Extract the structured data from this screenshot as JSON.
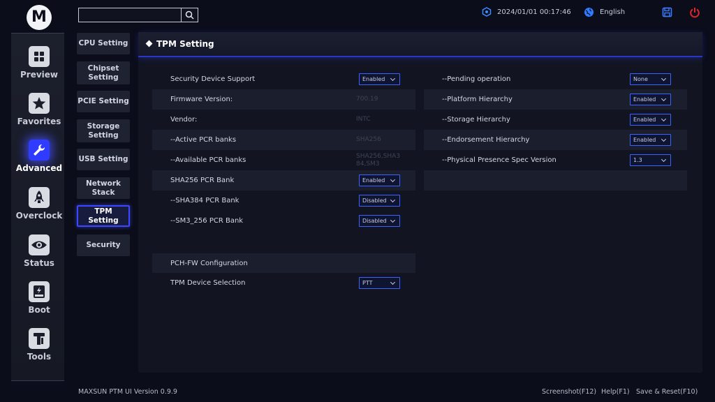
{
  "app": {
    "logo_letter": "M",
    "version": "MAXSUN PTM UI Version 0.9.9"
  },
  "top": {
    "search_placeholder": "",
    "datetime": "2024/01/01 00:17:46",
    "language": "English"
  },
  "colors": {
    "accent": "#2f3cff",
    "dropdown_border": "#3a66ff",
    "power": "#e0262b",
    "save": "#3a7bff"
  },
  "nav": [
    {
      "label": "Preview",
      "icon": "grid-icon",
      "active": false
    },
    {
      "label": "Favorites",
      "icon": "star-icon",
      "active": false
    },
    {
      "label": "Advanced",
      "icon": "wrench-icon",
      "active": true
    },
    {
      "label": "Overclock",
      "icon": "rocket-icon",
      "active": false
    },
    {
      "label": "Status",
      "icon": "eye-icon",
      "active": false
    },
    {
      "label": "Boot",
      "icon": "ssd-icon",
      "active": false
    },
    {
      "label": "Tools",
      "icon": "tools-icon",
      "active": false
    }
  ],
  "submenu": [
    {
      "label": "CPU Setting"
    },
    {
      "label": "Chipset\nSetting"
    },
    {
      "label": "PCIE Setting"
    },
    {
      "label": "Storage\nSetting"
    },
    {
      "label": "USB Setting"
    },
    {
      "label": "Network Stack"
    },
    {
      "label": "TPM Setting",
      "active": true
    },
    {
      "label": "Security"
    }
  ],
  "panel": {
    "title": "TPM Setting",
    "left": [
      {
        "label": "Security Device Support",
        "dropdown": "Enabled"
      },
      {
        "label": "Firmware Version:",
        "value": "700.19"
      },
      {
        "label": "Vendor:",
        "value": "INTC"
      },
      {
        "label": "--Active PCR banks",
        "value": "SHA256"
      },
      {
        "label": "--Available PCR banks",
        "value": "SHA256,SHA384,SM3"
      },
      {
        "label": "SHA256 PCR Bank",
        "dropdown": "Enabled"
      },
      {
        "label": "--SHA384 PCR Bank",
        "dropdown": "Disabled"
      },
      {
        "label": "--SM3_256 PCR Bank",
        "dropdown": "Disabled"
      }
    ],
    "pch_section": "PCH-FW Configuration",
    "pch_rows": [
      {
        "label": "TPM Device Selection",
        "dropdown": "PTT"
      }
    ],
    "right": [
      {
        "label": "--Pending operation",
        "dropdown": "None"
      },
      {
        "label": "--Platform Hierarchy",
        "dropdown": "Enabled"
      },
      {
        "label": "--Storage Hierarchy",
        "dropdown": "Enabled"
      },
      {
        "label": "--Endorsement Hierarchy",
        "dropdown": "Enabled"
      },
      {
        "label": "--Physical Presence Spec Version",
        "dropdown": "1.3"
      }
    ]
  },
  "footer": {
    "screenshot": "Screenshot(F12)",
    "help": "Help(F1)",
    "save_reset": "Save & Reset(F10)"
  }
}
